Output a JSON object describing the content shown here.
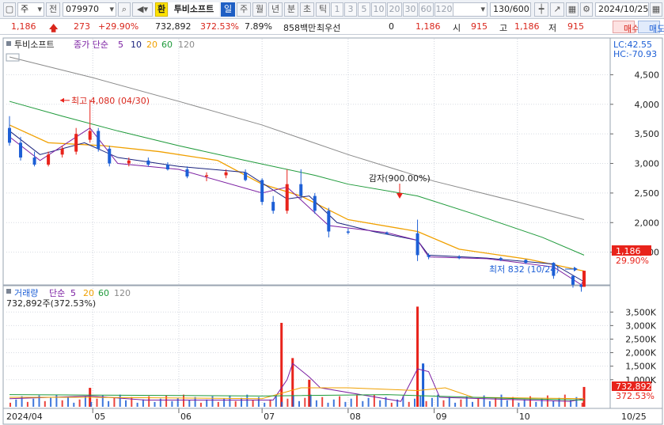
{
  "toolbar": {
    "market": "주",
    "stock_label": "전",
    "code": "079970",
    "badge": "환",
    "name": "투비소프트",
    "periods": [
      "일",
      "주",
      "월",
      "년",
      "분",
      "초",
      "틱"
    ],
    "active_period": "일",
    "intervals": [
      "1",
      "3",
      "5",
      "10",
      "20",
      "30",
      "60",
      "120"
    ],
    "count": "130/600",
    "date": "2024/10/25"
  },
  "quote": {
    "price": "1,186",
    "change": "273",
    "change_pct": "+29.90%",
    "volume": "732,892",
    "volume_pct": "372.53%",
    "turnover_pct": "7.89%",
    "amount": "858백만",
    "tag": "최우선",
    "tag_value": "0",
    "best_price": "1,186",
    "open_label": "시",
    "open": "915",
    "high_label": "고",
    "high": "1,186",
    "low_label": "저",
    "low": "915",
    "buy_label": "매수",
    "sell_label": "매도"
  },
  "price_panel": {
    "legend_name": "투비소프트",
    "legend_ma": "종가 단순",
    "ma_periods": [
      "5",
      "10",
      "20",
      "60",
      "120"
    ],
    "lc": "LC:42.55",
    "hc": "HC:-70.93",
    "y_ticks": [
      "4,500",
      "4,000",
      "3,500",
      "3,000",
      "2,500",
      "2,000",
      "1,500"
    ],
    "last_price": "1,186",
    "last_pct": "29.90%",
    "high_note": "최고 4,080 (04/30)",
    "low_note": "최저 832 (10/24)",
    "event_note": "감자(900.00%)"
  },
  "volume_panel": {
    "legend_name": "거래량",
    "legend_ma": "단순",
    "ma_periods": [
      "5",
      "20",
      "60",
      "120"
    ],
    "summary": "732,892주(372.53%)",
    "y_ticks": [
      "3,500K",
      "3,000K",
      "2,500K",
      "2,000K",
      "1,500K",
      "1,000K"
    ],
    "last_volume": "732,892",
    "last_pct": "372.53%"
  },
  "x_axis": {
    "labels": [
      "2024/04",
      "05",
      "06",
      "07",
      "08",
      "09",
      "10"
    ],
    "right_label": "10/25"
  },
  "colors": {
    "up": "#e8231b",
    "down": "#1d5fd6",
    "ma5": "#7b1fa2",
    "ma10": "#1a237e",
    "ma20": "#f0a000",
    "ma60": "#1e9a3a",
    "ma120": "#8a8a8a"
  },
  "chart_data": {
    "type": "candlestick",
    "price_scale": [
      1000,
      4800
    ],
    "volume_scale": [
      0,
      3800000
    ],
    "price_series": [
      {
        "d": "04-01",
        "o": 3600,
        "h": 3800,
        "l": 3300,
        "c": 3350
      },
      {
        "d": "04-05",
        "o": 3350,
        "h": 3450,
        "l": 3050,
        "c": 3100
      },
      {
        "d": "04-10",
        "o": 3100,
        "h": 3200,
        "l": 2950,
        "c": 2980
      },
      {
        "d": "04-15",
        "o": 2980,
        "h": 3200,
        "l": 2950,
        "c": 3150
      },
      {
        "d": "04-20",
        "o": 3150,
        "h": 3300,
        "l": 3100,
        "c": 3250
      },
      {
        "d": "04-25",
        "o": 3200,
        "h": 3600,
        "l": 3150,
        "c": 3500
      },
      {
        "d": "04-30",
        "o": 3400,
        "h": 4080,
        "l": 3350,
        "c": 3550
      },
      {
        "d": "05-03",
        "o": 3550,
        "h": 3600,
        "l": 3200,
        "c": 3250
      },
      {
        "d": "05-07",
        "o": 3250,
        "h": 3300,
        "l": 2950,
        "c": 3000
      },
      {
        "d": "05-14",
        "o": 3000,
        "h": 3100,
        "l": 2950,
        "c": 3050
      },
      {
        "d": "05-21",
        "o": 3050,
        "h": 3100,
        "l": 2950,
        "c": 2980
      },
      {
        "d": "05-28",
        "o": 2980,
        "h": 3020,
        "l": 2880,
        "c": 2900
      },
      {
        "d": "06-04",
        "o": 2900,
        "h": 2950,
        "l": 2750,
        "c": 2780
      },
      {
        "d": "06-11",
        "o": 2780,
        "h": 2850,
        "l": 2700,
        "c": 2800
      },
      {
        "d": "06-18",
        "o": 2800,
        "h": 2900,
        "l": 2750,
        "c": 2850
      },
      {
        "d": "06-25",
        "o": 2850,
        "h": 2900,
        "l": 2700,
        "c": 2720
      },
      {
        "d": "07-01",
        "o": 2720,
        "h": 2750,
        "l": 2300,
        "c": 2350
      },
      {
        "d": "07-05",
        "o": 2350,
        "h": 2450,
        "l": 2150,
        "c": 2200
      },
      {
        "d": "07-10",
        "o": 2200,
        "h": 2900,
        "l": 2150,
        "c": 2650
      },
      {
        "d": "07-15",
        "o": 2650,
        "h": 2900,
        "l": 2400,
        "c": 2450
      },
      {
        "d": "07-20",
        "o": 2450,
        "h": 2500,
        "l": 2150,
        "c": 2200
      },
      {
        "d": "07-25",
        "o": 2200,
        "h": 2250,
        "l": 1750,
        "c": 1850
      },
      {
        "d": "08-01",
        "o": 1850,
        "h": 1900,
        "l": 1800,
        "c": 1830
      },
      {
        "d": "08-15",
        "o": 1830,
        "h": 1850,
        "l": 1800,
        "c": 1820
      },
      {
        "d": "08-26",
        "o": 1820,
        "h": 2050,
        "l": 1350,
        "c": 1450
      },
      {
        "d": "08-30",
        "o": 1450,
        "h": 1480,
        "l": 1380,
        "c": 1420
      },
      {
        "d": "09-10",
        "o": 1420,
        "h": 1450,
        "l": 1380,
        "c": 1400
      },
      {
        "d": "09-25",
        "o": 1400,
        "h": 1420,
        "l": 1350,
        "c": 1370
      },
      {
        "d": "10-04",
        "o": 1370,
        "h": 1380,
        "l": 1300,
        "c": 1320
      },
      {
        "d": "10-14",
        "o": 1320,
        "h": 1330,
        "l": 1050,
        "c": 1100
      },
      {
        "d": "10-21",
        "o": 1100,
        "h": 1100,
        "l": 900,
        "c": 950
      },
      {
        "d": "10-24",
        "o": 950,
        "h": 960,
        "l": 832,
        "c": 913
      },
      {
        "d": "10-25",
        "o": 915,
        "h": 1186,
        "l": 915,
        "c": 1186
      }
    ],
    "volume_series": [
      {
        "d": "04-30",
        "v": 700000
      },
      {
        "d": "07-08",
        "v": 3100000
      },
      {
        "d": "07-12",
        "v": 1800000
      },
      {
        "d": "07-18",
        "v": 1000000
      },
      {
        "d": "08-26",
        "v": 3700000
      },
      {
        "d": "08-28",
        "v": 1600000
      },
      {
        "d": "10-25",
        "v": 732892
      }
    ]
  }
}
